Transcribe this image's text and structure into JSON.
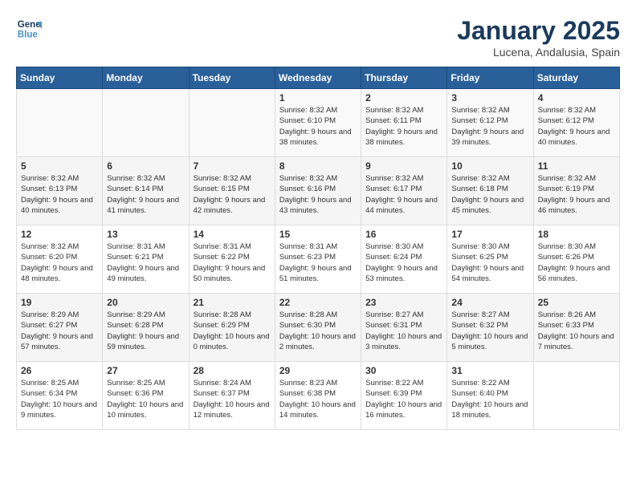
{
  "header": {
    "logo_line1": "General",
    "logo_line2": "Blue",
    "month": "January 2025",
    "location": "Lucena, Andalusia, Spain"
  },
  "weekdays": [
    "Sunday",
    "Monday",
    "Tuesday",
    "Wednesday",
    "Thursday",
    "Friday",
    "Saturday"
  ],
  "weeks": [
    [
      {
        "day": "",
        "info": ""
      },
      {
        "day": "",
        "info": ""
      },
      {
        "day": "",
        "info": ""
      },
      {
        "day": "1",
        "info": "Sunrise: 8:32 AM\nSunset: 6:10 PM\nDaylight: 9 hours\nand 38 minutes."
      },
      {
        "day": "2",
        "info": "Sunrise: 8:32 AM\nSunset: 6:11 PM\nDaylight: 9 hours\nand 38 minutes."
      },
      {
        "day": "3",
        "info": "Sunrise: 8:32 AM\nSunset: 6:12 PM\nDaylight: 9 hours\nand 39 minutes."
      },
      {
        "day": "4",
        "info": "Sunrise: 8:32 AM\nSunset: 6:12 PM\nDaylight: 9 hours\nand 40 minutes."
      }
    ],
    [
      {
        "day": "5",
        "info": "Sunrise: 8:32 AM\nSunset: 6:13 PM\nDaylight: 9 hours\nand 40 minutes."
      },
      {
        "day": "6",
        "info": "Sunrise: 8:32 AM\nSunset: 6:14 PM\nDaylight: 9 hours\nand 41 minutes."
      },
      {
        "day": "7",
        "info": "Sunrise: 8:32 AM\nSunset: 6:15 PM\nDaylight: 9 hours\nand 42 minutes."
      },
      {
        "day": "8",
        "info": "Sunrise: 8:32 AM\nSunset: 6:16 PM\nDaylight: 9 hours\nand 43 minutes."
      },
      {
        "day": "9",
        "info": "Sunrise: 8:32 AM\nSunset: 6:17 PM\nDaylight: 9 hours\nand 44 minutes."
      },
      {
        "day": "10",
        "info": "Sunrise: 8:32 AM\nSunset: 6:18 PM\nDaylight: 9 hours\nand 45 minutes."
      },
      {
        "day": "11",
        "info": "Sunrise: 8:32 AM\nSunset: 6:19 PM\nDaylight: 9 hours\nand 46 minutes."
      }
    ],
    [
      {
        "day": "12",
        "info": "Sunrise: 8:32 AM\nSunset: 6:20 PM\nDaylight: 9 hours\nand 48 minutes."
      },
      {
        "day": "13",
        "info": "Sunrise: 8:31 AM\nSunset: 6:21 PM\nDaylight: 9 hours\nand 49 minutes."
      },
      {
        "day": "14",
        "info": "Sunrise: 8:31 AM\nSunset: 6:22 PM\nDaylight: 9 hours\nand 50 minutes."
      },
      {
        "day": "15",
        "info": "Sunrise: 8:31 AM\nSunset: 6:23 PM\nDaylight: 9 hours\nand 51 minutes."
      },
      {
        "day": "16",
        "info": "Sunrise: 8:30 AM\nSunset: 6:24 PM\nDaylight: 9 hours\nand 53 minutes."
      },
      {
        "day": "17",
        "info": "Sunrise: 8:30 AM\nSunset: 6:25 PM\nDaylight: 9 hours\nand 54 minutes."
      },
      {
        "day": "18",
        "info": "Sunrise: 8:30 AM\nSunset: 6:26 PM\nDaylight: 9 hours\nand 56 minutes."
      }
    ],
    [
      {
        "day": "19",
        "info": "Sunrise: 8:29 AM\nSunset: 6:27 PM\nDaylight: 9 hours\nand 57 minutes."
      },
      {
        "day": "20",
        "info": "Sunrise: 8:29 AM\nSunset: 6:28 PM\nDaylight: 9 hours\nand 59 minutes."
      },
      {
        "day": "21",
        "info": "Sunrise: 8:28 AM\nSunset: 6:29 PM\nDaylight: 10 hours\nand 0 minutes."
      },
      {
        "day": "22",
        "info": "Sunrise: 8:28 AM\nSunset: 6:30 PM\nDaylight: 10 hours\nand 2 minutes."
      },
      {
        "day": "23",
        "info": "Sunrise: 8:27 AM\nSunset: 6:31 PM\nDaylight: 10 hours\nand 3 minutes."
      },
      {
        "day": "24",
        "info": "Sunrise: 8:27 AM\nSunset: 6:32 PM\nDaylight: 10 hours\nand 5 minutes."
      },
      {
        "day": "25",
        "info": "Sunrise: 8:26 AM\nSunset: 6:33 PM\nDaylight: 10 hours\nand 7 minutes."
      }
    ],
    [
      {
        "day": "26",
        "info": "Sunrise: 8:25 AM\nSunset: 6:34 PM\nDaylight: 10 hours\nand 9 minutes."
      },
      {
        "day": "27",
        "info": "Sunrise: 8:25 AM\nSunset: 6:36 PM\nDaylight: 10 hours\nand 10 minutes."
      },
      {
        "day": "28",
        "info": "Sunrise: 8:24 AM\nSunset: 6:37 PM\nDaylight: 10 hours\nand 12 minutes."
      },
      {
        "day": "29",
        "info": "Sunrise: 8:23 AM\nSunset: 6:38 PM\nDaylight: 10 hours\nand 14 minutes."
      },
      {
        "day": "30",
        "info": "Sunrise: 8:22 AM\nSunset: 6:39 PM\nDaylight: 10 hours\nand 16 minutes."
      },
      {
        "day": "31",
        "info": "Sunrise: 8:22 AM\nSunset: 6:40 PM\nDaylight: 10 hours\nand 18 minutes."
      },
      {
        "day": "",
        "info": ""
      }
    ]
  ]
}
